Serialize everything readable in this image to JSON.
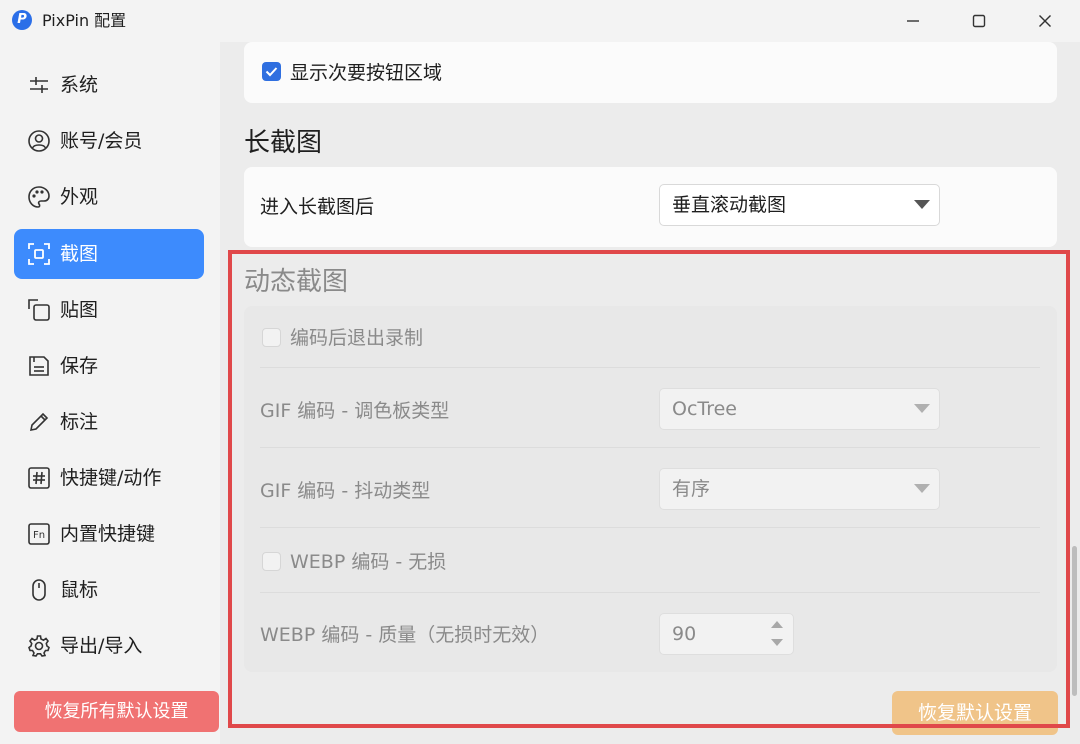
{
  "window": {
    "app_logo": "P",
    "title": "PixPin 配置"
  },
  "sidebar": {
    "items": [
      {
        "label": "系统",
        "icon": "sliders-icon"
      },
      {
        "label": "账号/会员",
        "icon": "user-icon"
      },
      {
        "label": "外观",
        "icon": "palette-icon"
      },
      {
        "label": "截图",
        "icon": "screenshot-icon",
        "active": true
      },
      {
        "label": "贴图",
        "icon": "pin-image-icon"
      },
      {
        "label": "保存",
        "icon": "save-icon"
      },
      {
        "label": "标注",
        "icon": "pencil-icon"
      },
      {
        "label": "快捷键/动作",
        "icon": "hash-icon"
      },
      {
        "label": "内置快捷键",
        "icon": "fn-key-icon"
      },
      {
        "label": "鼠标",
        "icon": "mouse-icon"
      },
      {
        "label": "导出/导入",
        "icon": "gear-icon"
      }
    ],
    "reset_all_label": "恢复所有默认设置"
  },
  "main": {
    "secondary_buttons": {
      "label": "显示次要按钮区域",
      "checked": true
    },
    "long_screenshot": {
      "title": "长截图",
      "after_enter_label": "进入长截图后",
      "after_enter_value": "垂直滚动截图"
    },
    "dynamic_screenshot": {
      "title": "动态截图",
      "exit_after_encode_label": "编码后退出录制",
      "exit_after_encode_checked": false,
      "gif_palette_label": "GIF 编码 - 调色板类型",
      "gif_palette_value": "OcTree",
      "gif_dither_label": "GIF 编码 - 抖动类型",
      "gif_dither_value": "有序",
      "webp_lossless_label": "WEBP 编码 - 无损",
      "webp_lossless_checked": false,
      "webp_quality_label": "WEBP 编码 - 质量（无损时无效）",
      "webp_quality_value": "90"
    },
    "reset_section_label": "恢复默认设置"
  },
  "colors": {
    "accent": "#3d8bfd",
    "reset_all": "#f07272",
    "reset_section": "#f0c489",
    "highlight": "#e0484a"
  }
}
